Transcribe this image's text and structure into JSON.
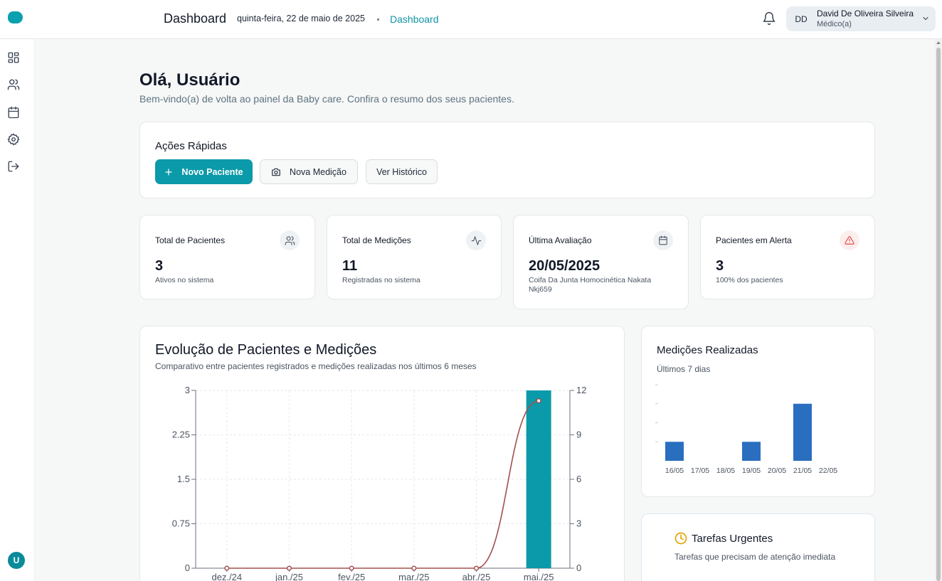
{
  "header": {
    "title": "Dashboard",
    "date": "quinta-feira, 22 de maio de 2025",
    "breadcrumb": "Dashboard",
    "user": {
      "initials": "DD",
      "name": "David De Oliveira Silveira",
      "role": "Médico(a)"
    }
  },
  "sidebar": {
    "items": [
      "dashboard-icon",
      "users-icon",
      "calendar-icon",
      "settings-icon",
      "logout-icon"
    ],
    "user_initial": "U"
  },
  "greeting": {
    "title": "Olá, Usuário",
    "subtitle": "Bem-vindo(a) de volta ao painel da Baby care. Confira o resumo dos seus pacientes."
  },
  "quick_actions": {
    "title": "Ações Rápidas",
    "new_patient": "Novo Paciente",
    "new_measurement": "Nova Medição",
    "history": "Ver Histórico"
  },
  "stats": [
    {
      "label": "Total de Pacientes",
      "value": "3",
      "sub": "Ativos no sistema",
      "icon": "users-icon"
    },
    {
      "label": "Total de Medições",
      "value": "11",
      "sub": "Registradas no sistema",
      "icon": "activity-icon"
    },
    {
      "label": "Última Avaliação",
      "value": "20/05/2025",
      "sub": "Coifa Da Junta Homocinética Nakata Nkj659",
      "icon": "calendar-icon"
    },
    {
      "label": "Pacientes em Alerta",
      "value": "3",
      "sub": "100% dos pacientes",
      "icon": "alert-icon"
    }
  ],
  "evolution_chart": {
    "title": "Evolução de Pacientes e Medições",
    "subtitle": "Comparativo entre pacientes registrados e medições realizadas nos últimos 6 meses"
  },
  "measurements_chart": {
    "title": "Medições Realizadas",
    "subtitle": "Últimos 7 dias"
  },
  "tasks": {
    "title": "Tarefas Urgentes",
    "subtitle": "Tarefas que precisam de atenção imediata"
  },
  "colors": {
    "accent": "#0b9aa9",
    "line": "#a35050",
    "bar_blue": "#2a6fbf",
    "alert": "#e24848"
  },
  "chart_data": [
    {
      "type": "bar",
      "categories": [
        "dez./24",
        "jan./25",
        "fev./25",
        "mar./25",
        "abr./25",
        "mai./25"
      ],
      "series": [
        {
          "values": [
            0,
            0,
            0,
            0,
            0,
            3
          ],
          "axis": "left",
          "kind": "bar"
        },
        {
          "values": [
            0,
            0,
            0,
            0,
            0,
            11.3
          ],
          "axis": "right",
          "kind": "line"
        }
      ],
      "y_left_ticks": [
        "0",
        "0.75",
        "1.5",
        "2.25",
        "3"
      ],
      "y_right_ticks": [
        "0",
        "3",
        "6",
        "9",
        "12"
      ],
      "ylim_left": [
        0,
        3
      ],
      "ylim_right": [
        0,
        12
      ],
      "grid": true
    },
    {
      "type": "bar",
      "categories": [
        "16/05",
        "17/05",
        "18/05",
        "19/05",
        "20/05",
        "21/05",
        "22/05"
      ],
      "values": [
        1,
        0,
        0,
        1,
        0,
        3,
        0
      ],
      "ylim": [
        0,
        4
      ]
    }
  ]
}
